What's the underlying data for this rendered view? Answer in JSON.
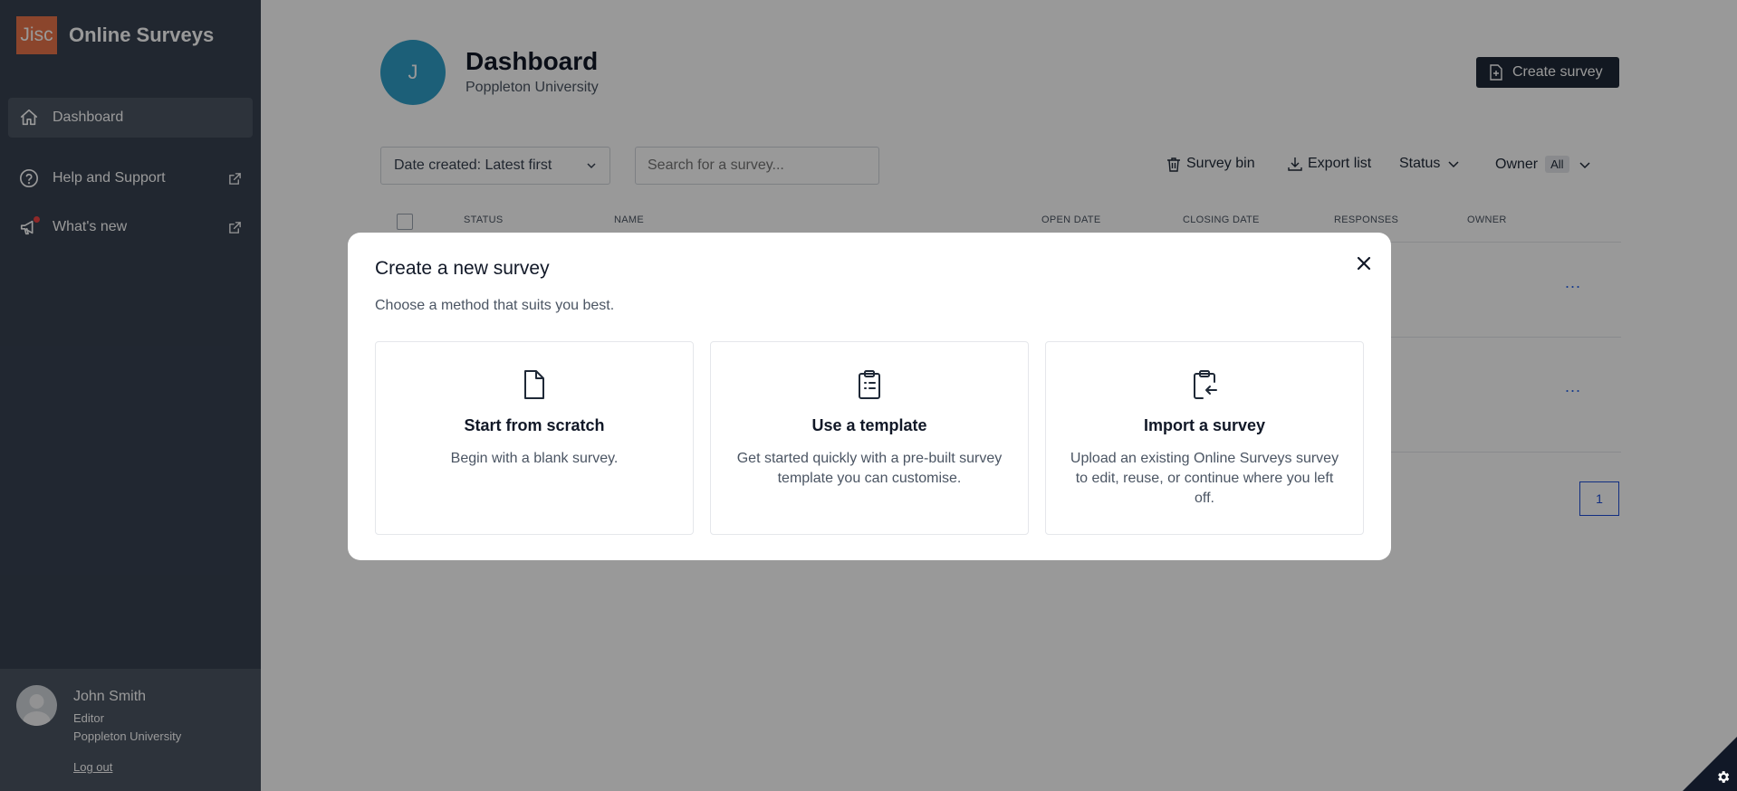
{
  "sidebar": {
    "logo_text": "Jisc",
    "app_title": "Online Surveys",
    "items": [
      {
        "label": "Dashboard"
      },
      {
        "label": "Help and Support"
      },
      {
        "label": "What's new"
      }
    ]
  },
  "user": {
    "name": "John Smith",
    "role": "Editor",
    "org": "Poppleton University",
    "logout": "Log out"
  },
  "header": {
    "avatar_letter": "J",
    "title": "Dashboard",
    "subtitle": "Poppleton University",
    "create_button": "Create survey"
  },
  "toolbar": {
    "sort_value": "Date created: Latest first",
    "search_placeholder": "Search for a survey...",
    "survey_bin": "Survey bin",
    "export_list": "Export list",
    "status": "Status",
    "owner": "Owner",
    "owner_value": "All"
  },
  "table": {
    "columns": [
      "STATUS",
      "NAME",
      "OPEN DATE",
      "CLOSING DATE",
      "RESPONSES",
      "OWNER"
    ],
    "more_label": "...",
    "page": "1"
  },
  "modal": {
    "title": "Create a new survey",
    "subtitle": "Choose a method that suits you best.",
    "options": [
      {
        "title": "Start from scratch",
        "desc": "Begin with a blank survey."
      },
      {
        "title": "Use a template",
        "desc": "Get started quickly with a pre-built survey template you can customise."
      },
      {
        "title": "Import a survey",
        "desc": "Upload an existing Online Surveys survey to edit, reuse, or continue where you left off."
      }
    ]
  },
  "icons": {
    "home": "home-icon",
    "help": "help-circle-icon",
    "megaphone": "megaphone-icon",
    "external": "external-link-icon",
    "file": "file-icon",
    "clipboard": "clipboard-list-icon",
    "import": "clipboard-import-icon",
    "close": "close-icon",
    "gear": "gear-icon"
  },
  "colors": {
    "sidebar": "#374151",
    "logo": "#e8744a",
    "avatar": "#2f9fc8",
    "accent": "#2563eb"
  }
}
